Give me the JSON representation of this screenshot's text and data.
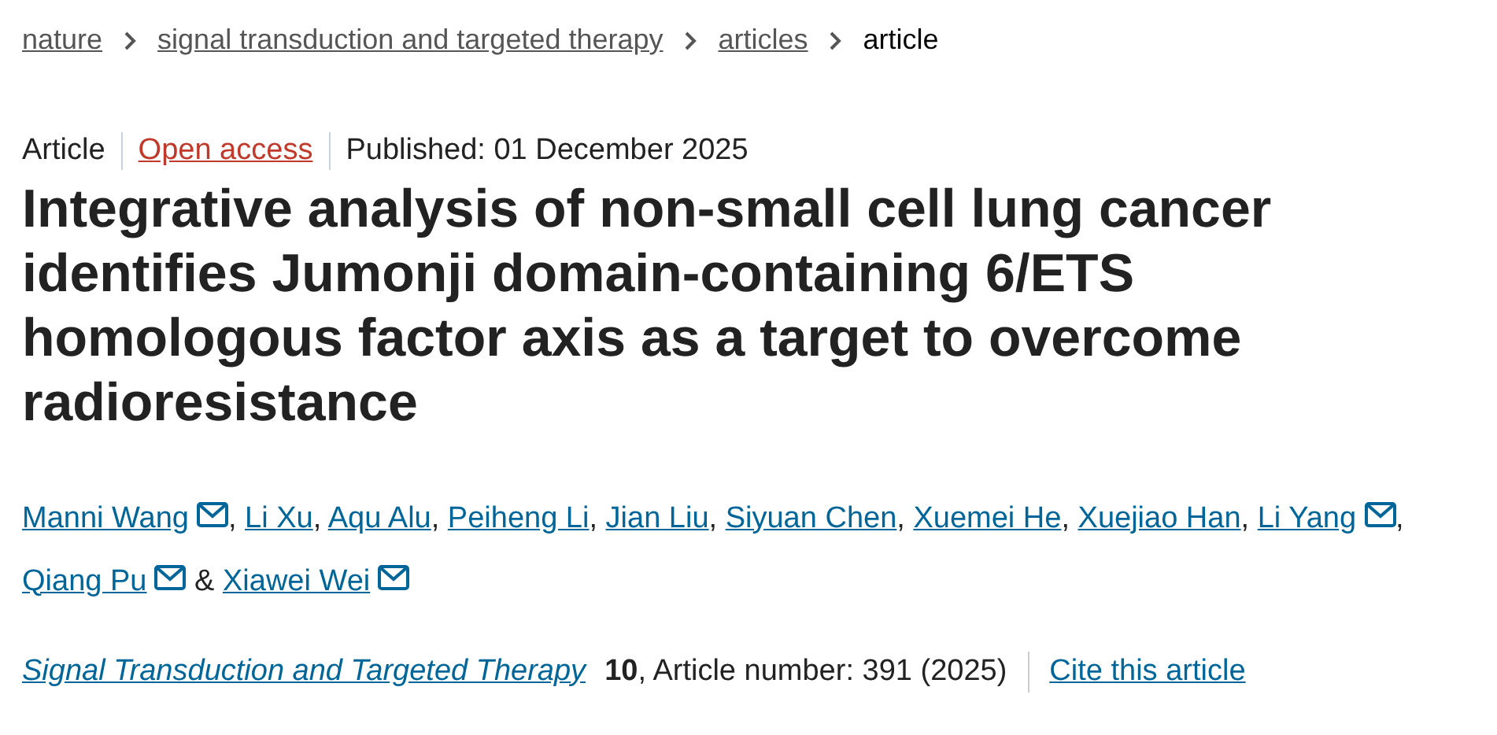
{
  "breadcrumb": [
    {
      "label": "nature",
      "current": false
    },
    {
      "label": "signal transduction and targeted therapy",
      "current": false
    },
    {
      "label": "articles",
      "current": false
    },
    {
      "label": "article",
      "current": true
    }
  ],
  "meta": {
    "type": "Article",
    "access": "Open access",
    "published": "Published: 01 December 2025"
  },
  "title": "Integrative analysis of non-small cell lung cancer identifies Jumonji domain-containing 6/ETS homologous factor axis as a target to overcome radioresistance",
  "authors": [
    {
      "name": "Manni Wang",
      "email": true,
      "sep": ","
    },
    {
      "name": "Li Xu",
      "email": false,
      "sep": ","
    },
    {
      "name": "Aqu Alu",
      "email": false,
      "sep": ","
    },
    {
      "name": "Peiheng Li",
      "email": false,
      "sep": ","
    },
    {
      "name": "Jian Liu",
      "email": false,
      "sep": ","
    },
    {
      "name": "Siyuan Chen",
      "email": false,
      "sep": ","
    },
    {
      "name": "Xuemei He",
      "email": false,
      "sep": ","
    },
    {
      "name": "Xuejiao Han",
      "email": false,
      "sep": ","
    },
    {
      "name": "Li Yang",
      "email": true,
      "sep": ","
    },
    {
      "name": "Qiang Pu",
      "email": true,
      "sep": "&"
    },
    {
      "name": "Xiawei Wei",
      "email": true
    }
  ],
  "citation": {
    "journal": "Signal Transduction and Targeted Therapy",
    "details": "**10**, Article number: 391 (2025)",
    "cite_link": "Cite this article"
  }
}
